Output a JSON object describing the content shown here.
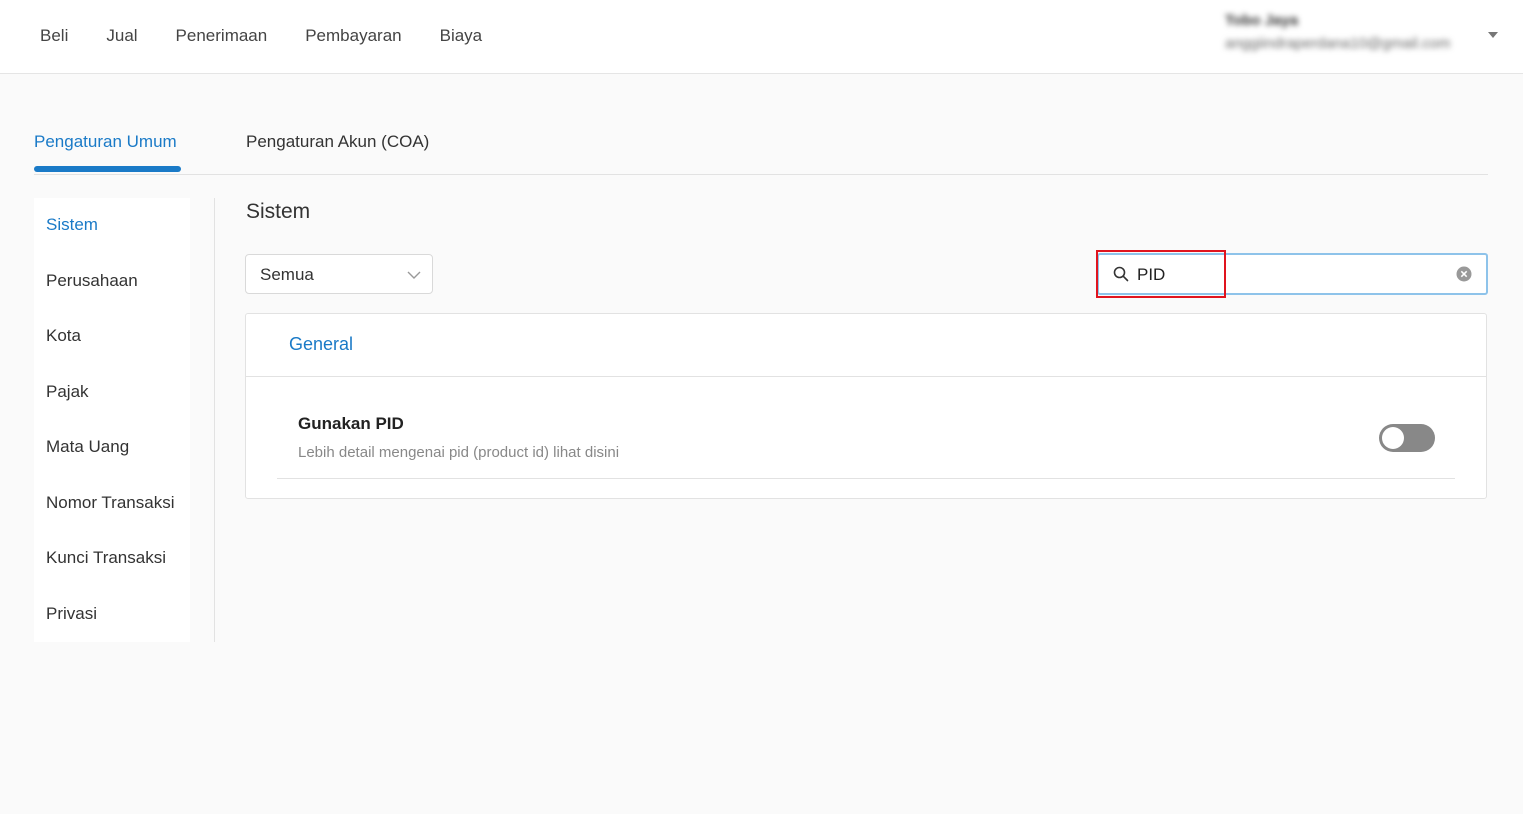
{
  "topnav": {
    "items": [
      "Beli",
      "Jual",
      "Penerimaan",
      "Pembayaran",
      "Biaya"
    ]
  },
  "user": {
    "name": "Tobo Jaya",
    "email": "anggiindraperdana10@gmail.com"
  },
  "tabs": {
    "general": "Pengaturan Umum",
    "coa": "Pengaturan Akun (COA)",
    "active": "general"
  },
  "sidebar": {
    "items": [
      {
        "label": "Sistem",
        "active": true
      },
      {
        "label": "Perusahaan",
        "active": false
      },
      {
        "label": "Kota",
        "active": false
      },
      {
        "label": "Pajak",
        "active": false
      },
      {
        "label": "Mata Uang",
        "active": false
      },
      {
        "label": "Nomor Transaksi",
        "active": false
      },
      {
        "label": "Kunci Transaksi",
        "active": false
      },
      {
        "label": "Privasi",
        "active": false
      }
    ]
  },
  "main": {
    "title": "Sistem",
    "filter": {
      "selected": "Semua"
    },
    "search": {
      "value": "PID"
    },
    "card": {
      "title": "General",
      "setting": {
        "name": "Gunakan PID",
        "description": "Lebih detail mengenai pid (product id) lihat disini",
        "enabled": false
      }
    }
  },
  "colors": {
    "accent": "#1a7ac7",
    "highlight": "#e0141e",
    "toggle_off": "#888888"
  },
  "icons": [
    "search-icon",
    "clear-icon",
    "chevron-down-icon",
    "caret-down-icon"
  ]
}
